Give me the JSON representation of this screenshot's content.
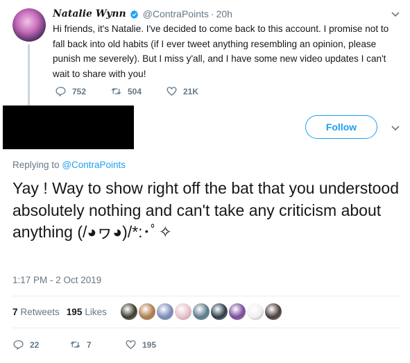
{
  "parent_tweet": {
    "display_name": "Natalie Wynn",
    "handle": "@ContraPoints",
    "separator": "·",
    "time": "20h",
    "text": "Hi friends, it's Natalie. I've decided to come back to this account. I promise not to fall back into old habits (if I ever tweet anything resembling an opinion, please punish me severely). But I miss y'all, and I have some new video updates I can't wait to share with you!",
    "replies": "752",
    "retweets": "504",
    "likes": "21K"
  },
  "reply_tweet": {
    "follow_label": "Follow",
    "replying_to_prefix": "Replying to",
    "replying_to_handle": "@ContraPoints",
    "text": "Yay ! Way to show right off the bat that you understood absolutely nothing and can't take any criticism about anything (/◕ヮ◕)/*:･ﾟ✧",
    "timestamp": "1:17 PM - 2 Oct 2019",
    "retweet_count": "7",
    "retweets_label": "Retweets",
    "like_count": "195",
    "likes_label": "Likes",
    "replies": "22",
    "retweets": "7",
    "likes": "195",
    "liker_colors": [
      "#3b3a2a",
      "#b07a4a",
      "#7a8ab8",
      "#e8c0c8",
      "#5a7a8a",
      "#2a3a4a",
      "#7a4a9a",
      "#f0f0f0",
      "#4a3a3a"
    ]
  },
  "colors": {
    "accent": "#1da1f2",
    "muted": "#657786",
    "divider": "#e6ecf0"
  }
}
